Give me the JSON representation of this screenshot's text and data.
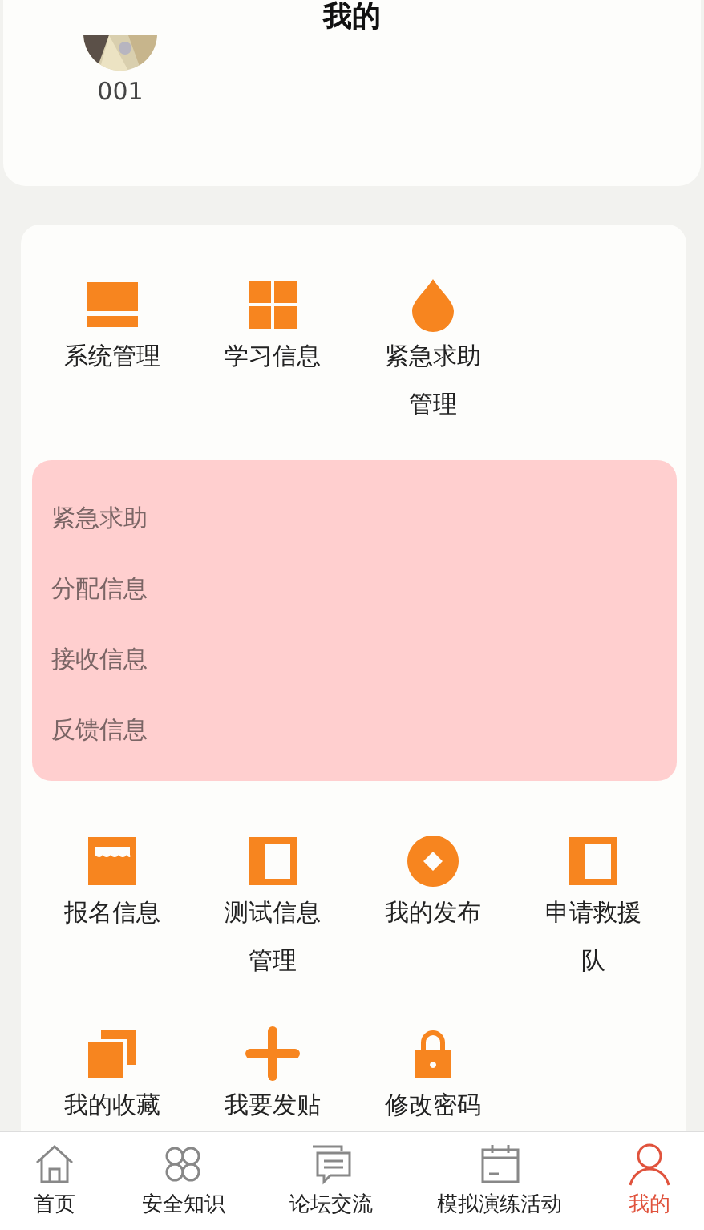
{
  "header": {
    "title": "我的"
  },
  "profile": {
    "username": "001"
  },
  "menu_rows": [
    {
      "items": [
        {
          "label": "系统管理"
        },
        {
          "label": "学习信息"
        },
        {
          "label": "紧急求助管理"
        }
      ],
      "dropdown": {
        "items": [
          "紧急求助",
          "分配信息",
          "接收信息",
          "反馈信息"
        ]
      }
    },
    {
      "items": [
        {
          "label": "报名信息"
        },
        {
          "label": "测试信息管理"
        },
        {
          "label": "我的发布"
        },
        {
          "label": "申请救援队"
        }
      ]
    },
    {
      "items": [
        {
          "label": "我的收藏"
        },
        {
          "label": "我要发贴"
        },
        {
          "label": "修改密码"
        }
      ]
    }
  ],
  "tab_bar": [
    {
      "label": "首页",
      "selected": false
    },
    {
      "label": "安全知识",
      "selected": false
    },
    {
      "label": "论坛交流",
      "selected": false
    },
    {
      "label": "模拟演练活动",
      "selected": false
    },
    {
      "label": "我的",
      "selected": true
    }
  ]
}
